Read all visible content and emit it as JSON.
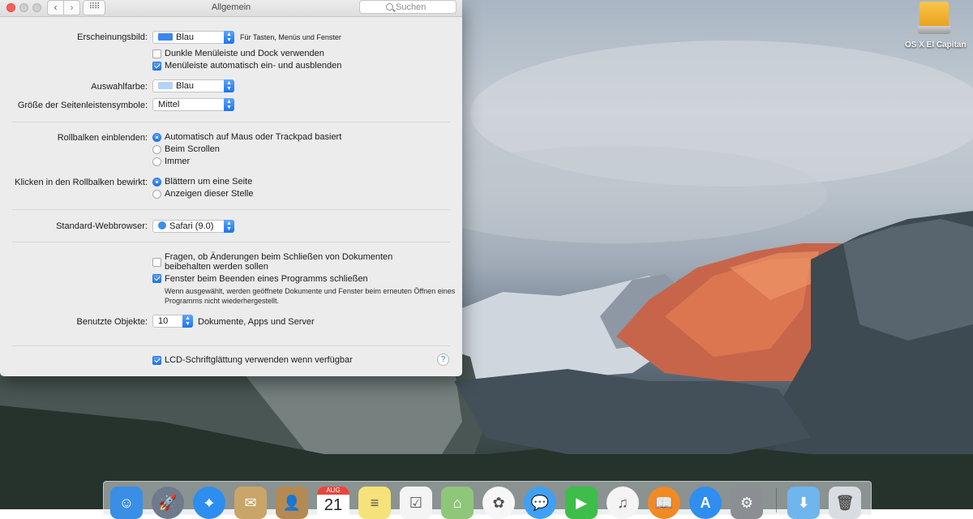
{
  "window": {
    "title": "Allgemein",
    "search_placeholder": "Suchen",
    "back_glyph": "‹",
    "forward_glyph": "›",
    "grid_glyph": "⠿⠿"
  },
  "appearance": {
    "label": "Erscheinungsbild:",
    "value": "Blau",
    "swatch_color": "#3d86f0",
    "note": "Für Tasten, Menüs und Fenster",
    "dark_menu_label": "Dunkle Menüleiste und Dock verwenden",
    "dark_menu_checked": false,
    "auto_hide_label": "Menüleiste automatisch ein- und ausblenden",
    "auto_hide_checked": true
  },
  "highlight": {
    "label": "Auswahlfarbe:",
    "value": "Blau",
    "swatch_color": "#b5d3f7"
  },
  "sidebar_size": {
    "label": "Größe der Seitenleistensymbole:",
    "value": "Mittel"
  },
  "scrollbars": {
    "label": "Rollbalken einblenden:",
    "options": [
      "Automatisch auf Maus oder Trackpad basiert",
      "Beim Scrollen",
      "Immer"
    ],
    "selected": 0
  },
  "click_scroll": {
    "label": "Klicken in den Rollbalken bewirkt:",
    "options": [
      "Blättern um eine Seite",
      "Anzeigen dieser Stelle"
    ],
    "selected": 0
  },
  "browser": {
    "label": "Standard-Webbrowser:",
    "value": "Safari (9.0)"
  },
  "documents": {
    "ask_label_line1": "Fragen, ob Änderungen beim Schließen von Dokumenten",
    "ask_label_line2": "beibehalten werden sollen",
    "ask_checked": false,
    "close_windows_label": "Fenster beim Beenden eines Programms schließen",
    "close_windows_checked": true,
    "hint_line1": "Wenn ausgewählt, werden geöffnete Dokumente und Fenster beim erneuten Öffnen eines",
    "hint_line2": "Programms nicht wiederhergestellt."
  },
  "recent": {
    "label": "Benutzte Objekte:",
    "value": "10",
    "suffix": "Dokumente, Apps und Server"
  },
  "lcd": {
    "label": "LCD-Schriftglättung verwenden wenn verfügbar",
    "checked": true
  },
  "help_glyph": "?",
  "desktop": {
    "drive_label": "OS X El Capitan"
  },
  "dock": {
    "calendar_month": "AUG",
    "calendar_day": "21",
    "items": [
      {
        "name": "finder-icon",
        "color": "#3a8ee6",
        "glyph": "☺"
      },
      {
        "name": "launchpad-icon",
        "color": "#6d7b8c",
        "glyph": "🚀"
      },
      {
        "name": "safari-icon",
        "color": "#2d8ef0",
        "glyph": "⌖"
      },
      {
        "name": "mail-icon",
        "color": "#c9a56a",
        "glyph": "✉"
      },
      {
        "name": "contacts-icon",
        "color": "#b58a52",
        "glyph": "👤"
      },
      {
        "name": "calendar-icon",
        "color": "#ffffff",
        "glyph": ""
      },
      {
        "name": "notes-icon",
        "color": "#f6e27a",
        "glyph": "≡"
      },
      {
        "name": "reminders-icon",
        "color": "#f4f4f4",
        "glyph": "☑"
      },
      {
        "name": "maps-icon",
        "color": "#8fc77a",
        "glyph": "⌂"
      },
      {
        "name": "photos-icon",
        "color": "#f7f7f7",
        "glyph": "✿"
      },
      {
        "name": "messages-icon",
        "color": "#3fa0f5",
        "glyph": "💬"
      },
      {
        "name": "facetime-icon",
        "color": "#3dbd4a",
        "glyph": "▶"
      },
      {
        "name": "itunes-icon",
        "color": "#f4f4f4",
        "glyph": "♫"
      },
      {
        "name": "ibooks-icon",
        "color": "#f08a24",
        "glyph": "📖"
      },
      {
        "name": "app-store-icon",
        "color": "#2f8ef0",
        "glyph": "A"
      },
      {
        "name": "system-preferences-icon",
        "color": "#8b8f94",
        "glyph": "⚙"
      },
      {
        "name": "downloads-folder-icon",
        "color": "#6fb5ee",
        "glyph": "⬇"
      },
      {
        "name": "trash-icon",
        "color": "#d9dde2",
        "glyph": "🗑"
      }
    ]
  }
}
